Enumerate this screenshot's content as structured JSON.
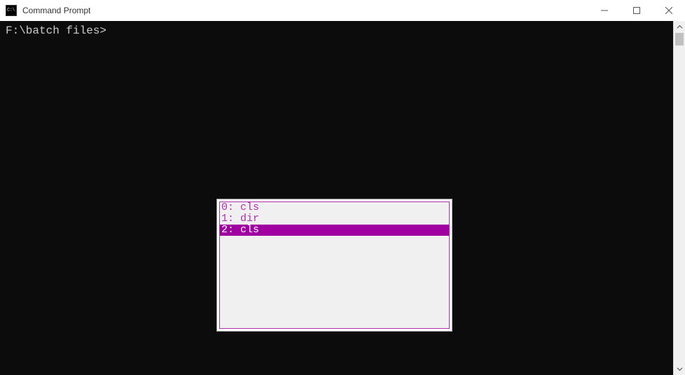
{
  "window": {
    "title": "Command Prompt",
    "icon_label": "C:\\"
  },
  "terminal": {
    "prompt": "F:\\batch files>"
  },
  "history": {
    "items": [
      {
        "index": "0",
        "sep": ": ",
        "cmd": "cls",
        "selected": false
      },
      {
        "index": "1",
        "sep": ": ",
        "cmd": "dir",
        "selected": false
      },
      {
        "index": "2",
        "sep": ": ",
        "cmd": "cls",
        "selected": true
      }
    ]
  }
}
